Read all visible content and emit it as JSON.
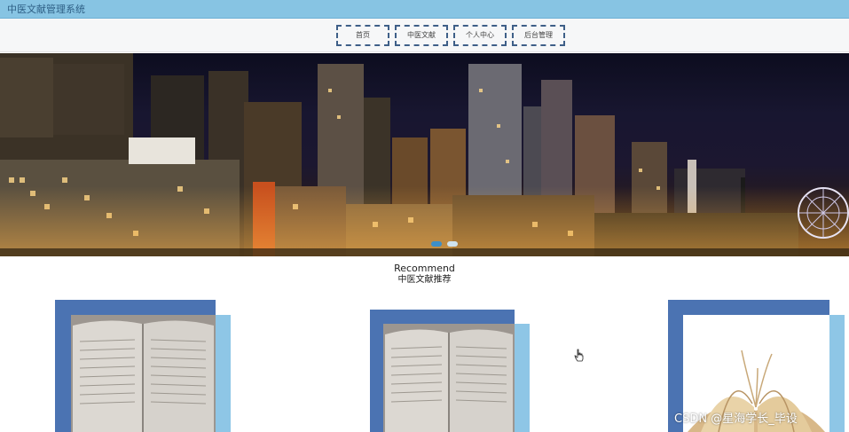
{
  "app": {
    "title": "中医文献管理系统"
  },
  "nav": {
    "items": [
      {
        "label": "首页"
      },
      {
        "label": "中医文献"
      },
      {
        "label": "个人中心"
      },
      {
        "label": "后台管理"
      }
    ]
  },
  "banner": {
    "image": "night-city-skyline",
    "indicators": {
      "count": 2,
      "active": 1
    }
  },
  "recommend": {
    "title_en": "Recommend",
    "title_cn": "中医文献推荐",
    "cards": [
      {
        "image": "open-book-photo"
      },
      {
        "image": "open-book-photo"
      },
      {
        "image": "open-book-fanned-pages"
      }
    ]
  },
  "overlay": {
    "watermark": "CSDN @星海学长_毕设"
  },
  "colors": {
    "titlebar": "#87c4e3",
    "nav_border": "#3e5f88",
    "card_back": "#4b73b2",
    "card_side": "#8ec6e6"
  }
}
